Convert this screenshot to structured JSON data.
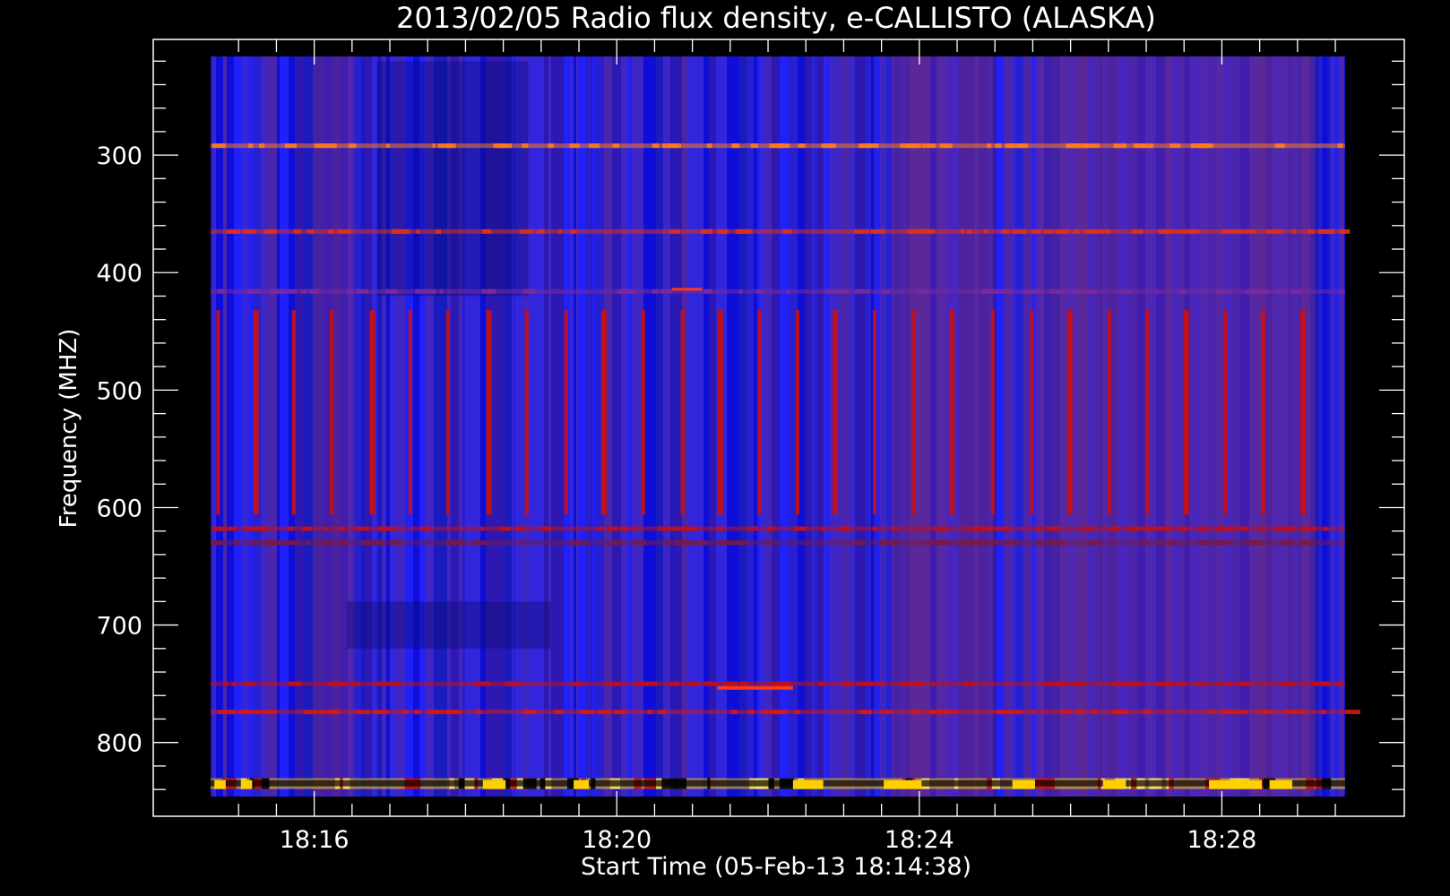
{
  "chart_data": {
    "type": "heatmap",
    "title": "2013/02/05  Radio flux density, e-CALLISTO (ALASKA)",
    "xlabel": "Start Time (05-Feb-13 18:14:38)",
    "ylabel": "Frequency (MHZ)",
    "x_axis": {
      "unit": "minutes after 18:14:38",
      "range": [
        0,
        15
      ],
      "tick_labels": [
        "18:16",
        "18:20",
        "18:24",
        "18:28"
      ],
      "tick_values": [
        1.37,
        5.37,
        9.37,
        13.37
      ]
    },
    "y_axis": {
      "unit": "MHz",
      "range": [
        216,
        846
      ],
      "inverted": true,
      "tick_labels": [
        "300",
        "400",
        "500",
        "600",
        "700",
        "800"
      ],
      "tick_values": [
        300,
        400,
        500,
        600,
        700,
        800
      ]
    },
    "colormap": [
      "#000000",
      "#0000ff",
      "#5a2a9a",
      "#c0101a",
      "#ff2a00",
      "#ffd000",
      "#ffffff"
    ],
    "background": "#1f1fe8",
    "periodic_bursts": {
      "times": [
        0.1,
        0.6,
        1.1,
        1.6,
        2.14,
        2.64,
        3.14,
        3.68,
        4.18,
        4.7,
        5.2,
        5.72,
        6.24,
        6.74,
        7.26,
        7.76,
        8.26,
        8.78,
        9.3,
        9.8,
        10.34,
        10.86,
        11.36,
        11.88,
        12.38,
        12.9,
        13.42,
        13.92,
        14.44
      ],
      "freq_range": [
        432,
        606
      ],
      "color": "#c0101a"
    },
    "interference_bands": [
      {
        "freq": 292,
        "color": "#ff7a1a"
      },
      {
        "freq": 365,
        "color": "#e0301a"
      },
      {
        "freq": 416,
        "color": "#7a2a9a"
      },
      {
        "freq": 618,
        "color": "#c0101a"
      },
      {
        "freq": 630,
        "color": "#7a1a40"
      },
      {
        "freq": 750,
        "color": "#c0101a"
      },
      {
        "freq": 774,
        "color": "#d01818"
      },
      {
        "freq": 835,
        "color": "#ffd000"
      }
    ]
  }
}
